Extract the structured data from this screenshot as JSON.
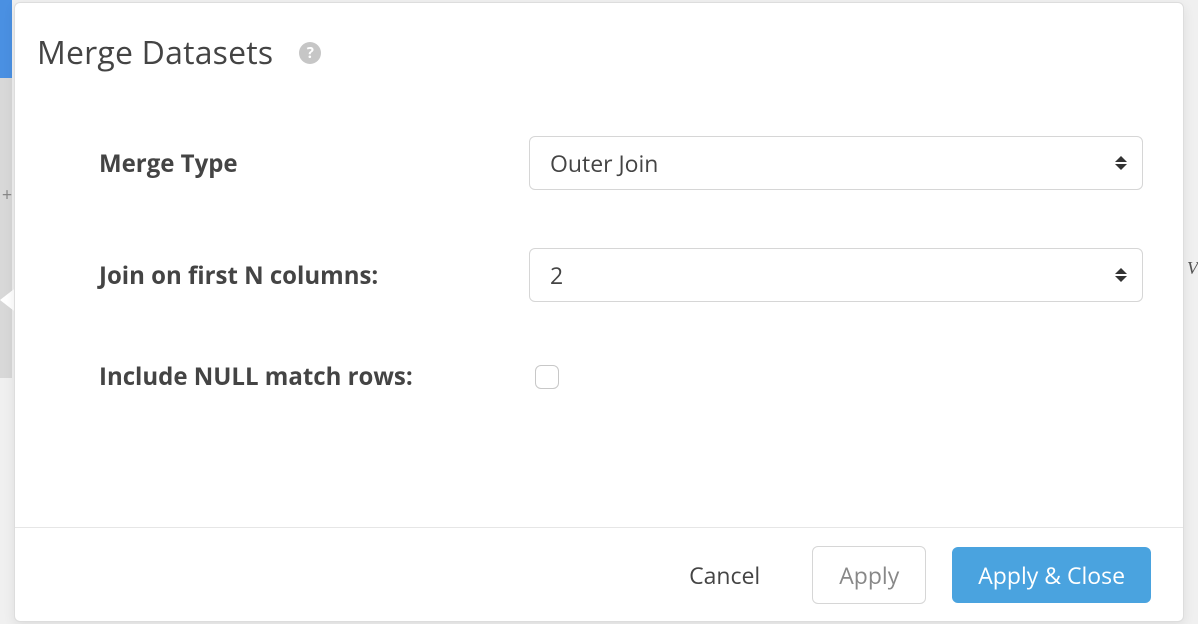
{
  "dialog": {
    "title": "Merge Datasets",
    "help_tooltip": "Help"
  },
  "fields": {
    "merge_type": {
      "label": "Merge Type",
      "value": "Outer Join"
    },
    "join_n_cols": {
      "label": "Join on first N columns:",
      "value": "2"
    },
    "include_null": {
      "label": "Include NULL match rows:",
      "checked": false
    }
  },
  "buttons": {
    "cancel": "Cancel",
    "apply": "Apply",
    "apply_close": "Apply & Close"
  }
}
